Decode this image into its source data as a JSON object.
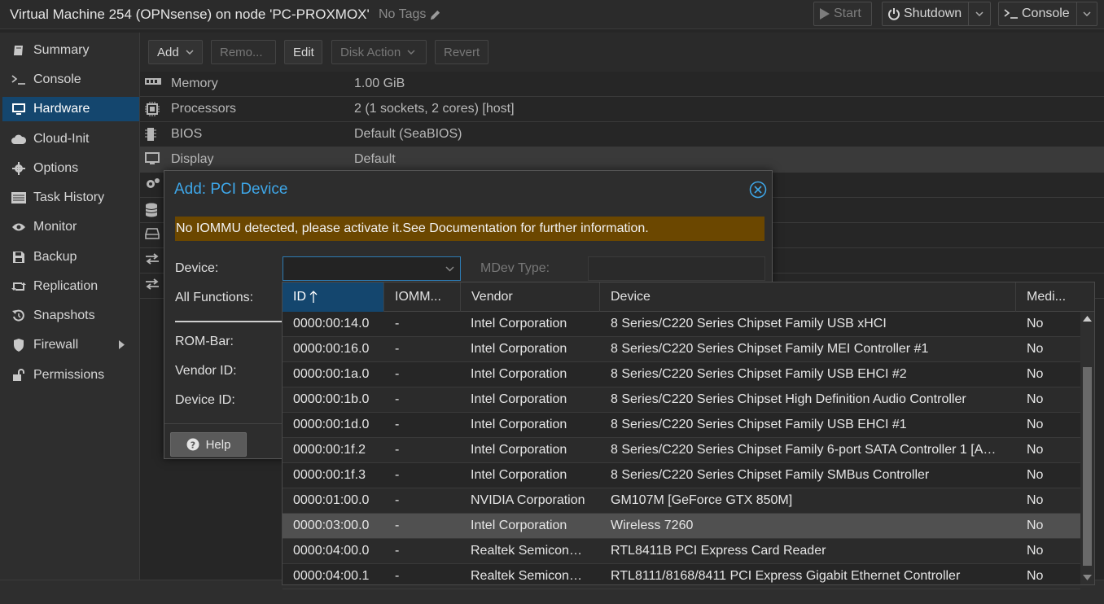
{
  "header": {
    "title": "Virtual Machine 254 (OPNsense) on node 'PC-PROXMOX'",
    "tags_label": "No Tags",
    "start_label": "Start",
    "shutdown_label": "Shutdown",
    "console_label": "Console"
  },
  "nav": {
    "items": [
      {
        "label": "Summary",
        "icon": "book-icon"
      },
      {
        "label": "Console",
        "icon": "terminal-icon"
      },
      {
        "label": "Hardware",
        "icon": "monitor-icon",
        "active": true
      },
      {
        "label": "Cloud-Init",
        "icon": "cloud-icon"
      },
      {
        "label": "Options",
        "icon": "gear-icon"
      },
      {
        "label": "Task History",
        "icon": "list-icon"
      },
      {
        "label": "Monitor",
        "icon": "eye-icon"
      },
      {
        "label": "Backup",
        "icon": "floppy-icon"
      },
      {
        "label": "Replication",
        "icon": "retweet-icon"
      },
      {
        "label": "Snapshots",
        "icon": "history-icon"
      },
      {
        "label": "Firewall",
        "icon": "shield-icon"
      },
      {
        "label": "Permissions",
        "icon": "unlock-icon"
      }
    ]
  },
  "toolbar": {
    "add_label": "Add",
    "remove_label": "Remo...",
    "edit_label": "Edit",
    "disk_action_label": "Disk Action",
    "revert_label": "Revert"
  },
  "hardware": {
    "rows": [
      {
        "key": "Memory",
        "value": "1.00 GiB"
      },
      {
        "key": "Processors",
        "value": "2 (1 sockets, 2 cores) [host]"
      },
      {
        "key": "BIOS",
        "value": "Default (SeaBIOS)"
      },
      {
        "key": "Display",
        "value": "Default"
      }
    ]
  },
  "dialog": {
    "title": "Add: PCI Device",
    "warning": "No IOMMU detected, please activate it.See Documentation for further information.",
    "device_label": "Device:",
    "mdev_label": "MDev Type:",
    "all_functions_label": "All Functions:",
    "rom_bar_label": "ROM-Bar:",
    "vendor_id_label": "Vendor ID:",
    "device_id_label": "Device ID:",
    "help_label": "Help"
  },
  "picker": {
    "columns": [
      "ID",
      "IOMM...",
      "Vendor",
      "Device",
      "Medi..."
    ],
    "rows": [
      {
        "id": "0000:00:14.0",
        "iommu": "-",
        "vendor": "Intel Corporation",
        "device": "8 Series/C220 Series Chipset Family USB xHCI",
        "mdev": "No"
      },
      {
        "id": "0000:00:16.0",
        "iommu": "-",
        "vendor": "Intel Corporation",
        "device": "8 Series/C220 Series Chipset Family MEI Controller #1",
        "mdev": "No"
      },
      {
        "id": "0000:00:1a.0",
        "iommu": "-",
        "vendor": "Intel Corporation",
        "device": "8 Series/C220 Series Chipset Family USB EHCI #2",
        "mdev": "No"
      },
      {
        "id": "0000:00:1b.0",
        "iommu": "-",
        "vendor": "Intel Corporation",
        "device": "8 Series/C220 Series Chipset High Definition Audio Controller",
        "mdev": "No"
      },
      {
        "id": "0000:00:1d.0",
        "iommu": "-",
        "vendor": "Intel Corporation",
        "device": "8 Series/C220 Series Chipset Family USB EHCI #1",
        "mdev": "No"
      },
      {
        "id": "0000:00:1f.2",
        "iommu": "-",
        "vendor": "Intel Corporation",
        "device": "8 Series/C220 Series Chipset Family 6-port SATA Controller 1 [A…",
        "mdev": "No"
      },
      {
        "id": "0000:00:1f.3",
        "iommu": "-",
        "vendor": "Intel Corporation",
        "device": "8 Series/C220 Series Chipset Family SMBus Controller",
        "mdev": "No"
      },
      {
        "id": "0000:01:00.0",
        "iommu": "-",
        "vendor": "NVIDIA Corporation",
        "device": "GM107M [GeForce GTX 850M]",
        "mdev": "No"
      },
      {
        "id": "0000:03:00.0",
        "iommu": "-",
        "vendor": "Intel Corporation",
        "device": "Wireless 7260",
        "mdev": "No"
      },
      {
        "id": "0000:04:00.0",
        "iommu": "-",
        "vendor": "Realtek Semicon…",
        "device": "RTL8411B PCI Express Card Reader",
        "mdev": "No"
      },
      {
        "id": "0000:04:00.1",
        "iommu": "-",
        "vendor": "Realtek Semicon…",
        "device": "RTL8111/8168/8411 PCI Express Gigabit Ethernet Controller",
        "mdev": "No"
      }
    ]
  },
  "colors": {
    "accent": "#14466e",
    "title_blue": "#3ea7e9",
    "warning_bg": "#6b4700"
  }
}
